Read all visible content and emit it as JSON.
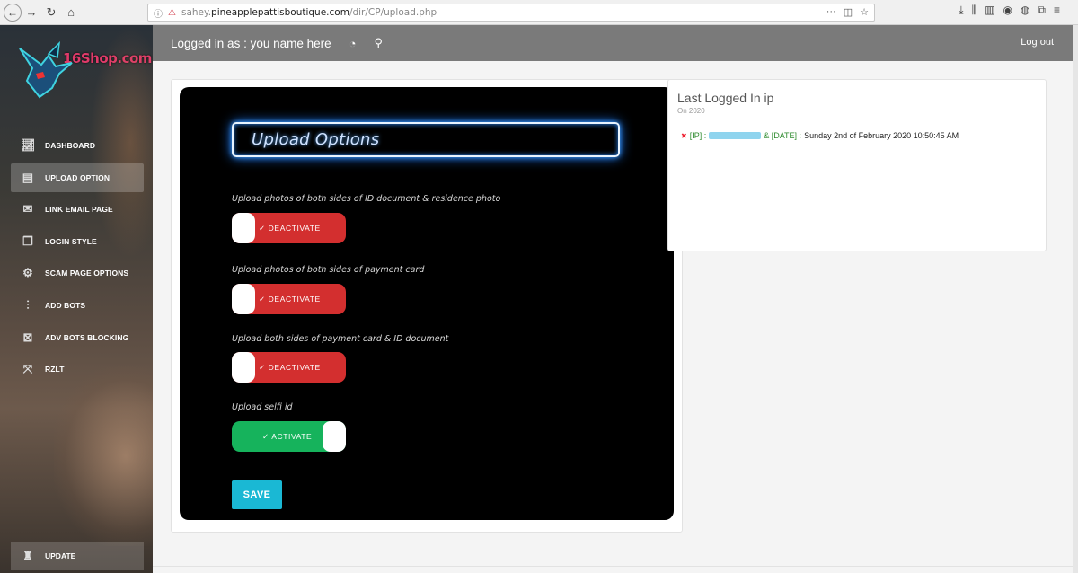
{
  "browser": {
    "url_prefix": "sahey.",
    "url_domain": "pineapplepattisboutique.com",
    "url_path": "/dir/CP/upload.php"
  },
  "sidebar": {
    "logo_text": "16Shop.com",
    "items": [
      {
        "label": "DASHBOARD",
        "icon": "chart-icon"
      },
      {
        "label": "UPLOAD OPTION",
        "icon": "upload-icon"
      },
      {
        "label": "LINK EMAIL PAGE",
        "icon": "mail-icon"
      },
      {
        "label": "LOGIN STYLE",
        "icon": "document-icon"
      },
      {
        "label": "SCAM PAGE OPTIONS",
        "icon": "gear-icon"
      },
      {
        "label": "ADD BOTS",
        "icon": "sliders-icon"
      },
      {
        "label": "ADV BOTS BLOCKING",
        "icon": "block-icon"
      },
      {
        "label": "RZLT",
        "icon": "arrows-icon"
      }
    ],
    "update_label": "UPDATE"
  },
  "topbar": {
    "logged_in": "Logged in as : you name here",
    "logout": "Log out"
  },
  "main": {
    "title": "Upload Options",
    "options": [
      {
        "label": "Upload photos of both sides of ID document & residence photo",
        "state": "✓ DEACTIVATE"
      },
      {
        "label": "Upload photos of both sides of payment card",
        "state": "✓ DEACTIVATE"
      },
      {
        "label": "Upload both sides of payment card & ID document",
        "state": "✓ DEACTIVATE"
      },
      {
        "label": "Upload selfi id",
        "state": "✓ ACTIVATE"
      }
    ],
    "save_label": "SAVE"
  },
  "last_login": {
    "title": "Last Logged In ip",
    "subtitle": "On 2020",
    "ip_tag": "[IP] :",
    "date_tag": "& [DATE] :",
    "date_value": "Sunday 2nd of February 2020 10:50:45 AM"
  }
}
